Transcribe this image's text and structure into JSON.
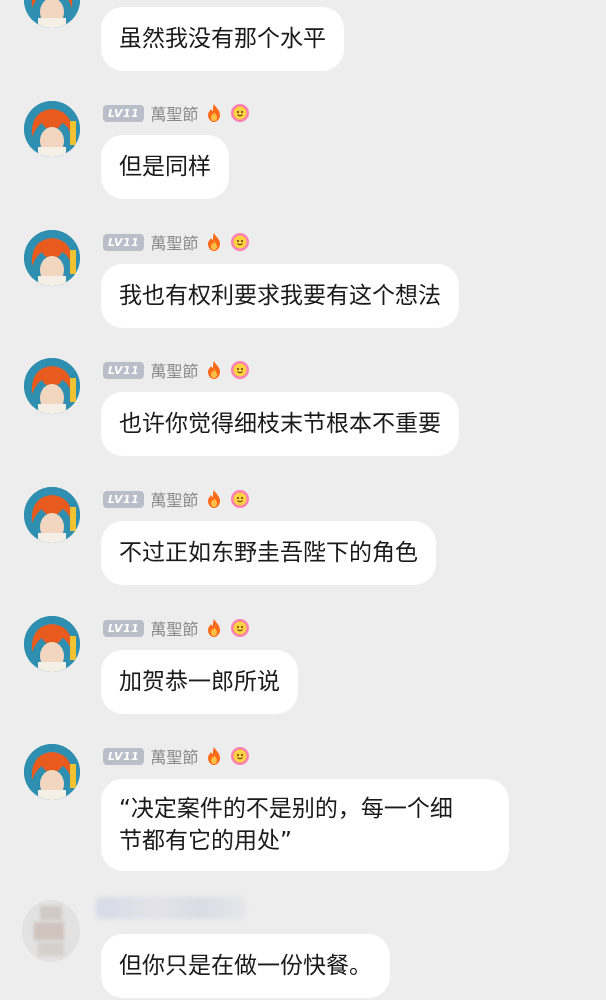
{
  "user": {
    "level_badge": "LV11",
    "nickname": "萬聖節"
  },
  "messages": [
    {
      "text": "虽然我没有那个水平",
      "show_header": false
    },
    {
      "text": "但是同样",
      "show_header": true
    },
    {
      "text": "我也有权利要求我要有这个想法",
      "show_header": true
    },
    {
      "text": "也许你觉得细枝末节根本不重要",
      "show_header": true
    },
    {
      "text": "不过正如东野圭吾陛下的角色",
      "show_header": true
    },
    {
      "text": "加贺恭一郎所说",
      "show_header": true
    },
    {
      "text": "“决定案件的不是别的，每一个细\n节都有它的用处”",
      "show_header": true
    }
  ],
  "other_message": {
    "text": "但你只是在做一份快餐。"
  },
  "colors": {
    "background": "#ededed",
    "bubble": "#ffffff",
    "badge": "#b9bec8",
    "nickname": "#8a8a8a",
    "avatar_bg": "#2f8fb0",
    "avatar_hair": "#e85a1e"
  },
  "icons": {
    "flame": "flame-icon",
    "face": "smiley-face-icon"
  }
}
